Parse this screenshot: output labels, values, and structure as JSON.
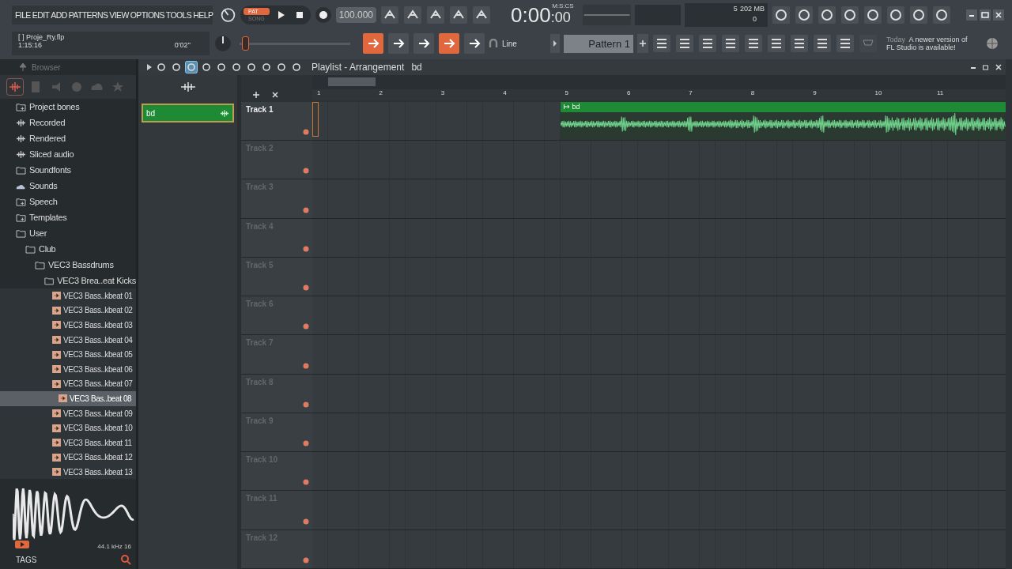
{
  "menu": [
    "FILE",
    "EDIT",
    "ADD",
    "PATTERNS",
    "VIEW",
    "OPTIONS",
    "TOOLS",
    "HELP"
  ],
  "project": {
    "name": "[    ] Proje_Ry.flp",
    "time": "1:15:16",
    "duration": "0'02''"
  },
  "modes": [
    {
      "label": "PAT",
      "selected": true
    },
    {
      "label": "SONG",
      "selected": false
    }
  ],
  "tempo": "100.000",
  "clock": {
    "main": "0:00",
    "cs": ":00",
    "unit": "M:S:CS"
  },
  "monitor": {
    "cpu": "5",
    "memory": "202 MB",
    "polyphony": "0"
  },
  "pitch": {
    "level": 0.02
  },
  "quick_buttons": [
    {
      "on": true
    },
    {
      "on": false
    },
    {
      "on": false
    },
    {
      "on": true
    },
    {
      "on": false
    }
  ],
  "snap": "Line",
  "pattern": "Pattern 1",
  "news": {
    "day": "Today",
    "message": "A newer version of FL Studio is available!"
  },
  "browser": {
    "title": "Browser",
    "items": [
      {
        "label": "Project bones",
        "kind": "special",
        "selected": false
      },
      {
        "label": "Recorded",
        "kind": "audio",
        "selected": false
      },
      {
        "label": "Rendered",
        "kind": "audio",
        "selected": false
      },
      {
        "label": "Sliced audio",
        "kind": "audio",
        "selected": false
      },
      {
        "label": "Soundfonts",
        "kind": "folder",
        "selected": false
      },
      {
        "label": "Sounds",
        "kind": "cloud",
        "selected": false
      },
      {
        "label": "Speech",
        "kind": "special",
        "selected": false
      },
      {
        "label": "Templates",
        "kind": "special",
        "selected": false
      },
      {
        "label": "User",
        "kind": "folder",
        "selected": false,
        "children": [
          {
            "label": "Club",
            "kind": "folder",
            "selected": false,
            "children": [
              {
                "label": "VEC3 Bassdrums",
                "kind": "folder",
                "selected": false,
                "children": [
                  {
                    "label": "VEC3 Brea..eat Kicks",
                    "kind": "folder",
                    "selected": false
                  }
                ]
              }
            ]
          }
        ]
      }
    ],
    "files": [
      {
        "label": "VEC3 Bass..kbeat 01",
        "selected": false
      },
      {
        "label": "VEC3 Bass..kbeat 02",
        "selected": false
      },
      {
        "label": "VEC3 Bass..kbeat 03",
        "selected": false
      },
      {
        "label": "VEC3 Bass..kbeat 04",
        "selected": false
      },
      {
        "label": "VEC3 Bass..kbeat 05",
        "selected": false
      },
      {
        "label": "VEC3 Bass..kbeat 06",
        "selected": false
      },
      {
        "label": "VEC3 Bass..kbeat 07",
        "selected": false
      },
      {
        "label": "VEC3 Bas..beat 08",
        "selected": true
      },
      {
        "label": "VEC3 Bass..kbeat 09",
        "selected": false
      },
      {
        "label": "VEC3 Bass..kbeat 10",
        "selected": false
      },
      {
        "label": "VEC3 Bass..kbeat 11",
        "selected": false
      },
      {
        "label": "VEC3 Bass..kbeat 12",
        "selected": false
      },
      {
        "label": "VEC3 Bass..kbeat 13",
        "selected": false
      }
    ],
    "sample_info": "44.1 kHz 16",
    "tags": "TAGS"
  },
  "playlist": {
    "title": "Playlist - Arrangement",
    "pattern": "bd",
    "picker_clip": "bd",
    "tools": [
      {
        "selected": false
      },
      {
        "selected": false
      },
      {
        "selected": true
      },
      {
        "selected": false
      },
      {
        "selected": false
      },
      {
        "selected": false
      },
      {
        "selected": false
      },
      {
        "selected": false
      },
      {
        "selected": false
      },
      {
        "selected": false
      }
    ],
    "bars": [
      "1",
      "2",
      "3",
      "4",
      "5",
      "6",
      "7",
      "8",
      "9",
      "10",
      "11"
    ],
    "tracks": [
      {
        "name": "Track 1",
        "active": true,
        "clip": {
          "label": "bd"
        }
      },
      {
        "name": "Track 2",
        "active": false
      },
      {
        "name": "Track 3",
        "active": false
      },
      {
        "name": "Track 4",
        "active": false
      },
      {
        "name": "Track 5",
        "active": false
      },
      {
        "name": "Track 6",
        "active": false
      },
      {
        "name": "Track 7",
        "active": false
      },
      {
        "name": "Track 8",
        "active": false
      },
      {
        "name": "Track 9",
        "active": false
      },
      {
        "name": "Track 10",
        "active": false
      },
      {
        "name": "Track 11",
        "active": false
      },
      {
        "name": "Track 12",
        "active": false
      }
    ]
  }
}
